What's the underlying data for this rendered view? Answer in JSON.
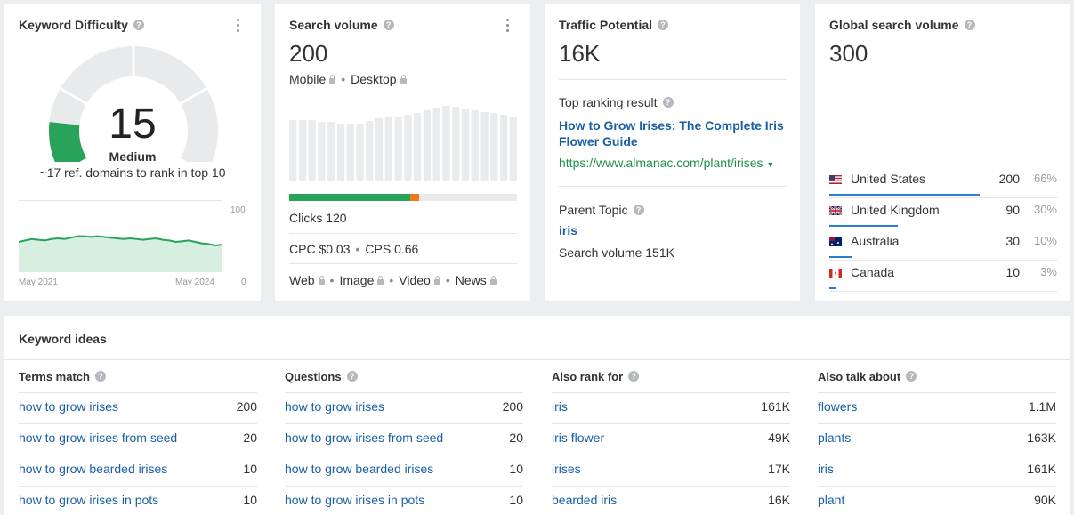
{
  "keyword_difficulty": {
    "title": "Keyword Difficulty",
    "score": "15",
    "label": "Medium",
    "subtitle": "~17 ref. domains to rank in top 10",
    "chart_max": "100",
    "chart_min": "0",
    "date_start": "May 2021",
    "date_end": "May 2024",
    "trend_values": [
      40,
      42,
      44,
      43,
      42,
      44,
      45,
      44,
      46,
      48,
      48,
      47,
      48,
      47,
      46,
      45,
      44,
      45,
      44,
      43,
      44,
      45,
      43,
      42,
      40,
      41,
      42,
      40,
      38,
      37,
      35,
      36
    ],
    "gauge_fraction": 0.15,
    "accent": "#2aa35a"
  },
  "search_volume": {
    "title": "Search volume",
    "value": "200",
    "mobile_label": "Mobile",
    "desktop_label": "Desktop",
    "bars": [
      69,
      69,
      69,
      67,
      67,
      65,
      65,
      65,
      68,
      71,
      72,
      73,
      75,
      77,
      80,
      83,
      85,
      84,
      82,
      80,
      78,
      77,
      75,
      73
    ],
    "clicks_label": "Clicks 120",
    "clicks_fractions": {
      "organic": 0.53,
      "orange": 0.04,
      "rest": 0.43
    },
    "cpc_label": "CPC $0.03",
    "cps_label": "CPS 0.66",
    "serp_types": [
      "Web",
      "Image",
      "Video",
      "News"
    ]
  },
  "traffic_potential": {
    "title": "Traffic Potential",
    "value": "16K",
    "top_ranking_label": "Top ranking result",
    "result_title": "How to Grow Irises: The Complete Iris Flower Guide",
    "result_url": "https://www.almanac.com/plant/irises",
    "parent_topic_label": "Parent Topic",
    "parent_topic": "iris",
    "parent_volume": "Search volume 151K"
  },
  "global_volume": {
    "title": "Global search volume",
    "value": "300",
    "countries": [
      {
        "name": "United States",
        "volume": "200",
        "pct": "66%",
        "share": 0.66,
        "flag": "us"
      },
      {
        "name": "United Kingdom",
        "volume": "90",
        "pct": "30%",
        "share": 0.3,
        "flag": "uk"
      },
      {
        "name": "Australia",
        "volume": "30",
        "pct": "10%",
        "share": 0.1,
        "flag": "au"
      },
      {
        "name": "Canada",
        "volume": "10",
        "pct": "3%",
        "share": 0.03,
        "flag": "ca"
      }
    ]
  },
  "keyword_ideas": {
    "title": "Keyword ideas",
    "columns": [
      {
        "header": "Terms match",
        "rows": [
          {
            "kw": "how to grow irises",
            "v": "200"
          },
          {
            "kw": "how to grow irises from seed",
            "v": "20"
          },
          {
            "kw": "how to grow bearded irises",
            "v": "10"
          },
          {
            "kw": "how to grow irises in pots",
            "v": "10"
          }
        ]
      },
      {
        "header": "Questions",
        "rows": [
          {
            "kw": "how to grow irises",
            "v": "200"
          },
          {
            "kw": "how to grow irises from seed",
            "v": "20"
          },
          {
            "kw": "how to grow bearded irises",
            "v": "10"
          },
          {
            "kw": "how to grow irises in pots",
            "v": "10"
          }
        ]
      },
      {
        "header": "Also rank for",
        "rows": [
          {
            "kw": "iris",
            "v": "161K"
          },
          {
            "kw": "iris flower",
            "v": "49K"
          },
          {
            "kw": "irises",
            "v": "17K"
          },
          {
            "kw": "bearded iris",
            "v": "16K"
          }
        ]
      },
      {
        "header": "Also talk about",
        "rows": [
          {
            "kw": "flowers",
            "v": "1.1M"
          },
          {
            "kw": "plants",
            "v": "163K"
          },
          {
            "kw": "iris",
            "v": "161K"
          },
          {
            "kw": "plant",
            "v": "90K"
          }
        ]
      }
    ]
  }
}
